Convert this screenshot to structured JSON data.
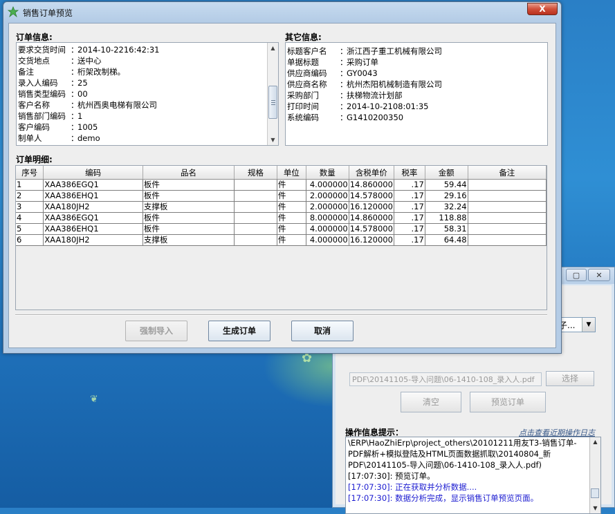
{
  "main_window": {
    "title": "销售订单预览",
    "close_label": "X"
  },
  "order_info": {
    "label": "订单信息:",
    "fields": [
      {
        "key": "要求交货时间",
        "value": "2014-10-2216:42:31"
      },
      {
        "key": "交货地点",
        "value": "送中心"
      },
      {
        "key": "备注",
        "value": "桁架改制梯。"
      },
      {
        "key": "录入人编码",
        "value": "25"
      },
      {
        "key": "销售类型编码",
        "value": "00"
      },
      {
        "key": "客户名称",
        "value": "杭州西奥电梯有限公司"
      },
      {
        "key": "销售部门编码",
        "value": "1"
      },
      {
        "key": "客户编码",
        "value": "1005"
      },
      {
        "key": "制单人",
        "value": "demo"
      }
    ]
  },
  "other_info": {
    "label": "其它信息:",
    "fields": [
      {
        "key": "标题客户名",
        "value": "浙江西子重工机械有限公司"
      },
      {
        "key": "单据标题",
        "value": "采购订单"
      },
      {
        "key": "供应商编码",
        "value": "GY0043"
      },
      {
        "key": "供应商名称",
        "value": "杭州杰阳机械制造有限公司"
      },
      {
        "key": "采购部门",
        "value": "扶梯物流计划部"
      },
      {
        "key": "打印时间",
        "value": "2014-10-2108:01:35"
      },
      {
        "key": "系统编码",
        "value": "G1410200350"
      }
    ]
  },
  "order_detail": {
    "label": "订单明细:",
    "columns": [
      "序号",
      "编码",
      "品名",
      "规格",
      "单位",
      "数量",
      "含税单价",
      "税率",
      "金额",
      "备注"
    ],
    "rows": [
      [
        "1",
        "XAA386EGQ1",
        "板件",
        "",
        "件",
        "4.000000",
        "14.860000",
        ".17",
        "59.44",
        ""
      ],
      [
        "2",
        "XAA386EHQ1",
        "板件",
        "",
        "件",
        "2.000000",
        "14.578000",
        ".17",
        "29.16",
        ""
      ],
      [
        "3",
        "XAA180JH2",
        "支撑板",
        "",
        "件",
        "2.000000",
        "16.120000",
        ".17",
        "32.24",
        ""
      ],
      [
        "4",
        "XAA386EGQ1",
        "板件",
        "",
        "件",
        "8.000000",
        "14.860000",
        ".17",
        "118.88",
        ""
      ],
      [
        "5",
        "XAA386EHQ1",
        "板件",
        "",
        "件",
        "4.000000",
        "14.578000",
        ".17",
        "58.31",
        ""
      ],
      [
        "6",
        "XAA180JH2",
        "支撑板",
        "",
        "件",
        "4.000000",
        "16.120000",
        ".17",
        "64.48",
        ""
      ]
    ]
  },
  "buttons": {
    "force_import": "强制导入",
    "generate_order": "生成订单",
    "cancel": "取消"
  },
  "background_window": {
    "combo_value": "子...",
    "file_path": "PDF\\20141105-导入问题\\06-1410-108_录入人.pdf",
    "select_button": "选择",
    "clear_button": "清空",
    "preview_button": "预览订单",
    "log_label": "操作信息提示：",
    "log_link": "点击查看近期操作日志",
    "log_lines": [
      {
        "text": "\\ERP\\HaoZhiErp\\project_others\\20101211用友T3-销售订单-",
        "blue": false
      },
      {
        "text": "PDF解析+模拟登陆及HTML页面数据抓取\\20140804_新",
        "blue": false
      },
      {
        "text": "PDF\\20141105-导入问题\\06-1410-108_录入人.pdf)",
        "blue": false
      },
      {
        "text": "[17:07:30]: 预览订单。",
        "blue": false
      },
      {
        "text": "[17:07:30]: 正在获取并分析数据....",
        "blue": true
      },
      {
        "text": "[17:07:30]: 数据分析完成，显示销售订单预览页面。",
        "blue": true
      }
    ]
  },
  "colors": {
    "desktop": "#2f8fd4",
    "titlebar": "#b4cce6",
    "close_button": "#c8442e",
    "log_blue": "#1a1ad0"
  }
}
